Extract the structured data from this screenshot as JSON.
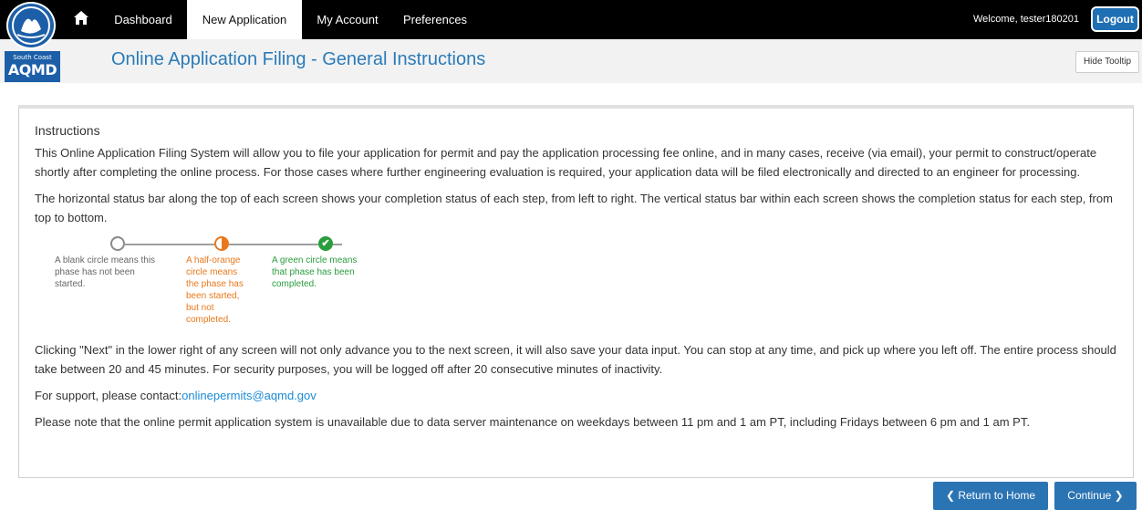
{
  "logo": {
    "small_text": "South Coast",
    "big_text": "AQMD"
  },
  "nav": {
    "home_icon": "home-icon",
    "items": [
      {
        "label": "Dashboard",
        "active": false
      },
      {
        "label": "New Application",
        "active": true
      },
      {
        "label": "My Account",
        "active": false
      },
      {
        "label": "Preferences",
        "active": false
      }
    ],
    "welcome": "Welcome, tester180201",
    "logout": "Logout"
  },
  "header": {
    "title": "Online Application Filing - General Instructions",
    "tooltip_button": "Hide Tooltip"
  },
  "instructions": {
    "title": "Instructions",
    "p1": "This Online Application Filing System will allow you to file your application for permit and pay the application processing fee online, and in many cases, receive (via email), your permit to construct/operate shortly after completing the online process. For those cases where further engineering evaluation is required, your application data will be filed electronically and directed to an engineer for processing.",
    "p2": "The horizontal status bar along the top of each screen shows your completion status of each step, from left to right. The vertical status bar within each screen shows the completion status for each step, from top to bottom.",
    "legend": {
      "blank": "A blank circle means this phase has not been started.",
      "half": "A half-orange circle means the phase has been started, but not completed.",
      "done": "A green circle means that phase has been completed.",
      "check_icon": "✔"
    },
    "p3": "Clicking \"Next\" in the lower right of any screen will not only advance you to the next screen, it will also save your data input. You can stop at any time, and pick up where you left off. The entire process should take between 20 and 45 minutes. For security purposes, you will be logged off after 20 consecutive minutes of inactivity.",
    "support_prefix": "For support, please contact:",
    "support_email": "onlinepermits@aqmd.gov",
    "p4": "Please note that the online permit application system is unavailable due to data server maintenance on weekdays between 11 pm and 1 am PT, including Fridays between 6 pm and 1 am PT."
  },
  "buttons": {
    "return_home": "❮ Return to Home",
    "continue": "Continue ❯"
  },
  "colors": {
    "nav_bg": "#000000",
    "brand_blue": "#2b74b4",
    "title_blue": "#2a7bb8",
    "orange": "#e9781b",
    "green": "#2a9d3e"
  }
}
